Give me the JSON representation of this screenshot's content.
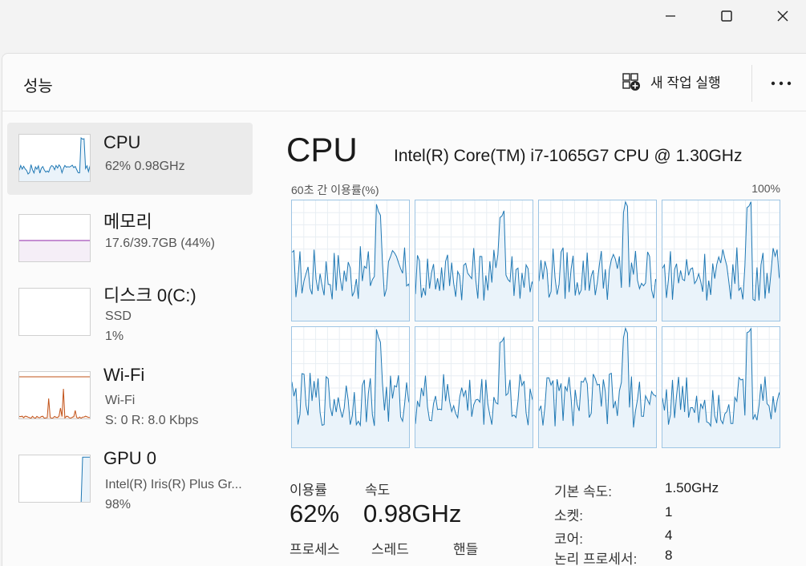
{
  "window": {
    "minimize_icon": "minimize-icon",
    "maximize_icon": "maximize-icon",
    "close_icon": "close-icon"
  },
  "header": {
    "title": "성능",
    "run_task_label": "새 작업 실행",
    "run_task_icon": "run-new-task-icon",
    "more_icon": "more-options-icon"
  },
  "sidebar": {
    "items": [
      {
        "name": "CPU",
        "sub1": "62%  0.98GHz",
        "sub2": "",
        "sub3": "",
        "color": "#1f78b4",
        "selected": true
      },
      {
        "name": "메모리",
        "sub1": "17.6/39.7GB (44%)",
        "sub2": "",
        "sub3": "",
        "color": "#8e24aa",
        "selected": false
      },
      {
        "name": "디스크 0(C:)",
        "sub1": "SSD",
        "sub2": "1%",
        "sub3": "",
        "color": "#2e7d32",
        "selected": false
      },
      {
        "name": "Wi-Fi",
        "sub1": "Wi-Fi",
        "sub2": "S:  0  R:  8.0 Kbps",
        "sub3": "",
        "color": "#c2531a",
        "selected": false
      },
      {
        "name": "GPU 0",
        "sub1": "Intel(R) Iris(R) Plus Gr...",
        "sub2": "98%",
        "sub3": "",
        "color": "#1f78b4",
        "selected": false
      }
    ]
  },
  "main": {
    "title": "CPU",
    "model": "Intel(R) Core(TM) i7-1065G7 CPU @ 1.30GHz",
    "graph_label_left": "60초 간 이용률(%)",
    "graph_label_right": "100%",
    "accent_color": "#1f78b4",
    "stats": {
      "utilization_label": "이용률",
      "utilization_value": "62%",
      "speed_label": "속도",
      "speed_value": "0.98GHz",
      "processes_label": "프로세스",
      "threads_label": "스레드",
      "handles_label": "핸들"
    },
    "specs": [
      {
        "key": "기본 속도:",
        "value": "1.50GHz"
      },
      {
        "key": "소켓:",
        "value": "1"
      },
      {
        "key": "코어:",
        "value": "4"
      },
      {
        "key": "논리 프로세서:",
        "value": "8"
      }
    ]
  }
}
